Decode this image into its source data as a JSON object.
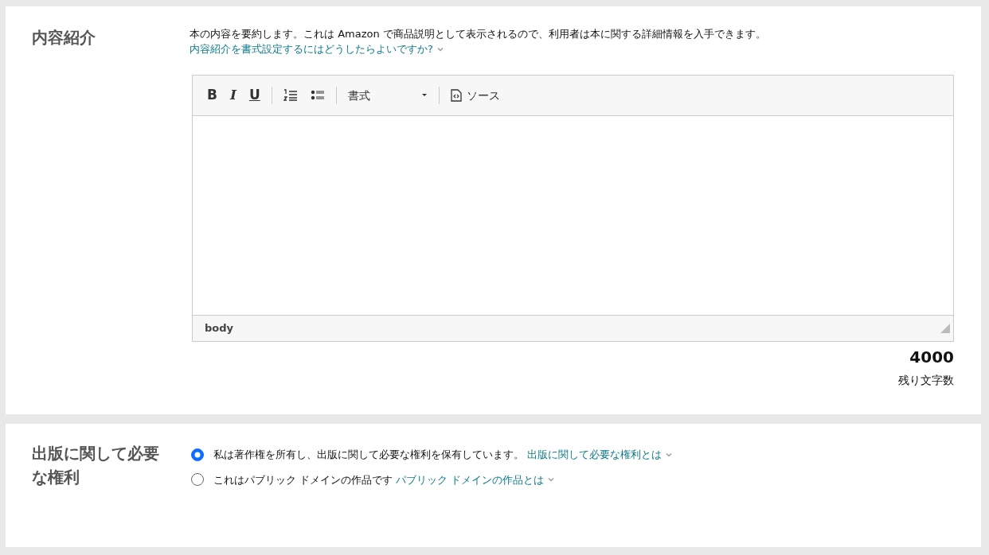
{
  "description_section": {
    "heading": "内容紹介",
    "help_text": "本の内容を要約します。これは Amazon で商品説明として表示されるので、利用者は本に関する詳細情報を入手できます。",
    "help_link": "内容紹介を書式設定するにはどうしたらよいですか?",
    "editor": {
      "toolbar": [
        {
          "kind": "bold",
          "label": "B"
        },
        {
          "kind": "italic",
          "label": "I"
        },
        {
          "kind": "underline",
          "label": "U"
        },
        {
          "kind": "sep"
        },
        {
          "kind": "ol"
        },
        {
          "kind": "ul"
        },
        {
          "kind": "sep"
        },
        {
          "kind": "format",
          "label": "書式"
        },
        {
          "kind": "sep"
        },
        {
          "kind": "source",
          "label": "ソース"
        }
      ],
      "path": "body"
    },
    "counter": "4000",
    "counter_label": "残り文字数"
  },
  "rights_section": {
    "heading": "出版に関して必要な権利",
    "options": [
      {
        "label": "私は著作権を所有し、出版に関して必要な権利を保有しています。",
        "link": "出版に関して必要な権利とは",
        "selected": true
      },
      {
        "label": "これはパブリック ドメインの作品です",
        "link": "パブリック ドメインの作品とは",
        "selected": false
      }
    ]
  }
}
